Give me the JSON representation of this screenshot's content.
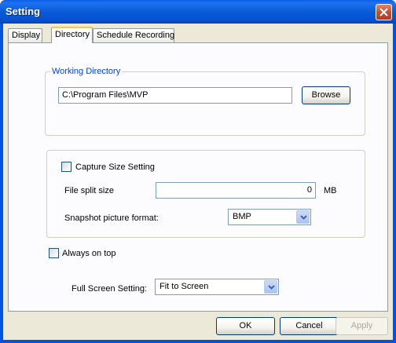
{
  "window": {
    "title": "Setting"
  },
  "tabs": [
    {
      "label": "Display"
    },
    {
      "label": "Directory"
    },
    {
      "label": "Schedule Recording"
    }
  ],
  "working_directory": {
    "group_label": "Working Directory",
    "path_value": "C:\\Program Files\\MVP",
    "browse_label": "Browse"
  },
  "capture": {
    "checkbox_label": "Capture Size Setting",
    "split_label": "File split size",
    "split_value": "0",
    "split_unit": "MB",
    "format_label": "Snapshot picture format:",
    "format_value": "BMP"
  },
  "always_on_top": {
    "label": "Always on top"
  },
  "full_screen": {
    "label": "Full Screen Setting:",
    "value": "Fit to Screen"
  },
  "footer": {
    "ok": "OK",
    "cancel": "Cancel",
    "apply": "Apply"
  },
  "colors": {
    "title_blue": "#0a5bd8",
    "accent_tab": "#ffc83c",
    "group_label_blue": "#0046d5"
  },
  "icons": {
    "close": "close-icon",
    "dropdown": "chevron-down-icon"
  }
}
